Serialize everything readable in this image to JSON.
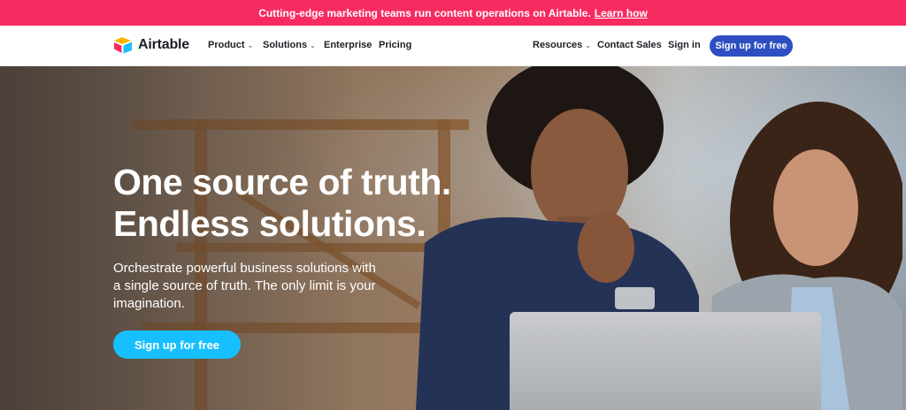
{
  "banner": {
    "text": "Cutting-edge marketing teams run content operations on Airtable.",
    "link": "Learn how",
    "bg_color": "#f82b60"
  },
  "nav": {
    "logo_text": "Airtable",
    "items": [
      {
        "label": "Product",
        "has_dropdown": true
      },
      {
        "label": "Solutions",
        "has_dropdown": true
      },
      {
        "label": "Enterprise",
        "has_dropdown": false
      },
      {
        "label": "Pricing",
        "has_dropdown": false
      }
    ],
    "right_items": [
      {
        "label": "Resources",
        "has_dropdown": true
      },
      {
        "label": "Contact Sales",
        "has_dropdown": false
      },
      {
        "label": "Sign in",
        "has_dropdown": false
      }
    ],
    "signup_label": "Sign up for free",
    "signup_color": "#2d4fc1"
  },
  "hero": {
    "headline_line1": "One source of truth.",
    "headline_line2": "Endless solutions.",
    "subtext": "Orchestrate powerful business solutions with a single source of truth. The only limit is your imagination.",
    "cta_label": "Sign up for free",
    "cta_color": "#18bfff"
  }
}
